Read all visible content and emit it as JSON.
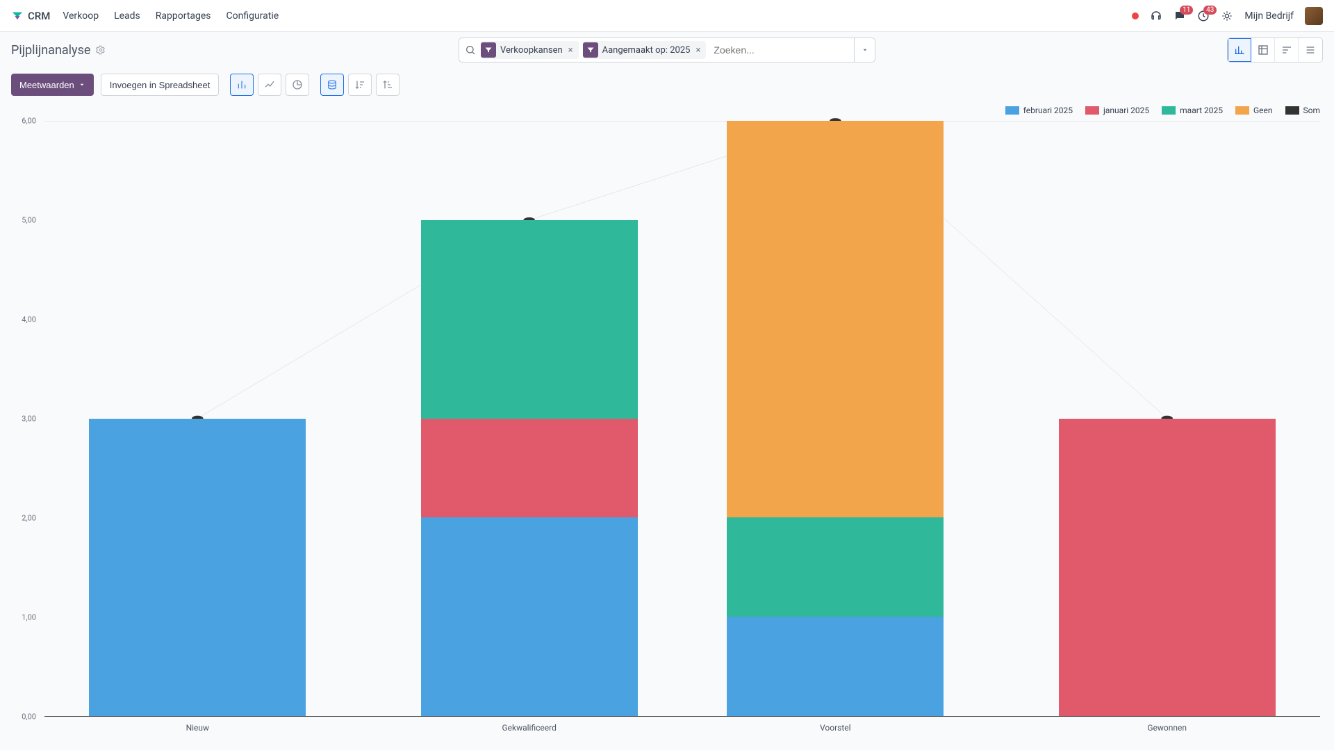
{
  "brand": "CRM",
  "nav": [
    "Verkoop",
    "Leads",
    "Rapportages",
    "Configuratie"
  ],
  "badges": {
    "messages": "11",
    "activities": "43"
  },
  "company": "Mijn Bedrijf",
  "page_title": "Pijplijnanalyse",
  "search": {
    "placeholder": "Zoeken...",
    "chips": [
      {
        "label": "Verkoopkansen"
      },
      {
        "label": "Aangemaakt op: 2025"
      }
    ]
  },
  "toolbar": {
    "measures": "Meetwaarden",
    "spreadsheet": "Invoegen in Spreadsheet"
  },
  "legend": [
    {
      "name": "februari 2025",
      "color": "#4aa3e0"
    },
    {
      "name": "januari 2025",
      "color": "#e05a6b"
    },
    {
      "name": "maart 2025",
      "color": "#30b89b"
    },
    {
      "name": "Geen",
      "color": "#f2a54a"
    },
    {
      "name": "Som",
      "color": "#333333"
    }
  ],
  "chart_data": {
    "type": "bar",
    "stacked": true,
    "ylabel": "",
    "xlabel": "",
    "ylim": [
      0,
      6
    ],
    "y_ticks": [
      "0,00",
      "1,00",
      "2,00",
      "3,00",
      "4,00",
      "5,00",
      "6,00"
    ],
    "categories": [
      "Nieuw",
      "Gekwalificeerd",
      "Voorstel",
      "Gewonnen"
    ],
    "series": [
      {
        "name": "februari 2025",
        "color": "#4aa3e0",
        "values": [
          3,
          2,
          1,
          0
        ]
      },
      {
        "name": "januari 2025",
        "color": "#e05a6b",
        "values": [
          0,
          1,
          0,
          3
        ]
      },
      {
        "name": "maart 2025",
        "color": "#30b89b",
        "values": [
          0,
          2,
          1,
          0
        ]
      },
      {
        "name": "Geen",
        "color": "#f2a54a",
        "values": [
          0,
          0,
          4,
          0
        ]
      }
    ],
    "sum_line": [
      3,
      5,
      6,
      3
    ]
  }
}
